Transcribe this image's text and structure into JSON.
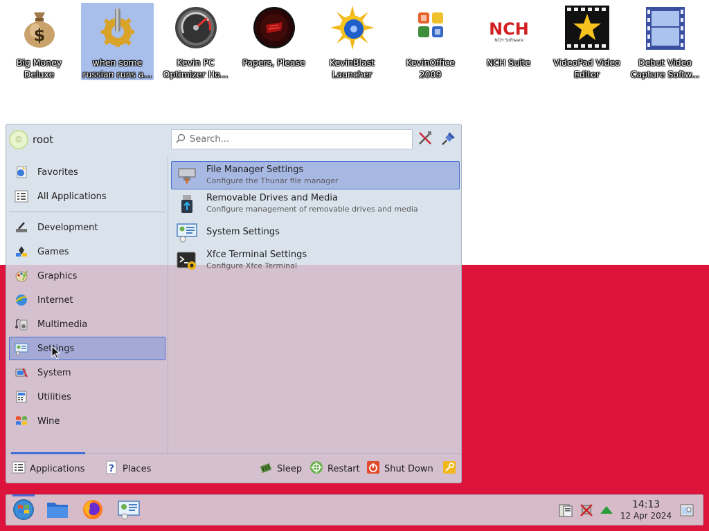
{
  "desktop": {
    "icons": [
      {
        "label": "Big Money Deluxe",
        "icon": "money-bag-icon"
      },
      {
        "label": "when some russian runs a...",
        "icon": "gear-icon"
      },
      {
        "label": "Kevin PC Optimizer Ho...",
        "icon": "gauge-icon"
      },
      {
        "label": "Papers, Please",
        "icon": "papers-please-icon"
      },
      {
        "label": "KevinBlast Launcher",
        "icon": "sun-disc-icon"
      },
      {
        "label": "KevinOffice 2009",
        "icon": "office-icon"
      },
      {
        "label": "NCH Suite",
        "icon": "nch-logo-icon"
      },
      {
        "label": "VideoPad Video Editor",
        "icon": "star-film-icon"
      },
      {
        "label": "Debut Video Capture Softw...",
        "icon": "film-strip-icon"
      }
    ],
    "selected_index": 1
  },
  "menu": {
    "username": "root",
    "search_placeholder": "Search...",
    "categories_top": [
      {
        "label": "Favorites",
        "icon": "favorites-icon"
      },
      {
        "label": "All Applications",
        "icon": "all-apps-icon"
      }
    ],
    "categories": [
      {
        "label": "Development",
        "icon": "development-icon"
      },
      {
        "label": "Games",
        "icon": "games-icon"
      },
      {
        "label": "Graphics",
        "icon": "graphics-icon"
      },
      {
        "label": "Internet",
        "icon": "internet-icon"
      },
      {
        "label": "Multimedia",
        "icon": "multimedia-icon"
      },
      {
        "label": "Settings",
        "icon": "settings-icon"
      },
      {
        "label": "System",
        "icon": "system-icon"
      },
      {
        "label": "Utilities",
        "icon": "utilities-icon"
      },
      {
        "label": "Wine",
        "icon": "wine-icon"
      }
    ],
    "active_category": "Settings",
    "apps": [
      {
        "name": "File Manager Settings",
        "desc": "Configure the Thunar file manager",
        "icon": "file-manager-settings-icon"
      },
      {
        "name": "Removable Drives and Media",
        "desc": "Configure management of removable drives and media",
        "icon": "usb-drive-icon"
      },
      {
        "name": "System Settings",
        "desc": "",
        "icon": "system-settings-icon"
      },
      {
        "name": "Xfce Terminal Settings",
        "desc": "Configure Xfce Terminal",
        "icon": "terminal-settings-icon"
      }
    ],
    "bottom": {
      "applications": "Applications",
      "places": "Places",
      "sleep": "Sleep",
      "restart": "Restart",
      "shutdown": "Shut Down"
    }
  },
  "taskbar": {
    "time": "14:13",
    "date": "12 Apr 2024"
  }
}
